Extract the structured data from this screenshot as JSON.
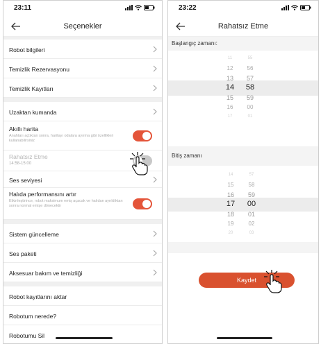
{
  "screen1": {
    "status_time": "23:11",
    "title": "Seçenekler",
    "rows": {
      "robot_info": "Robot bilgileri",
      "cleaning_reservation": "Temizlik Rezervasyonu",
      "cleaning_records": "Temizlik Kayıtları",
      "remote_control": "Uzaktan kumanda",
      "smart_map": "Akıllı harita",
      "smart_map_desc": "Anahtarı açtıktan sonra, haritayı odalara ayırma gibi özellikleri kullanabilirsiniz",
      "dnd": "Rahatsız Etme",
      "dnd_time": "14:58-15:00",
      "volume": "Ses seviyesi",
      "carpet_boost": "Halıda performansını artır",
      "carpet_boost_desc": "Etkinleştirince, robot maksimum emiş açacak ve halıdan ayrıldıktan sonra normal emişe dönecektir",
      "system_update": "Sistem güncelleme",
      "voice_pack": "Ses paketi",
      "accessory_care": "Aksesuar bakım ve temizliği",
      "transfer_robot": "Robot kayıtlarını aktar",
      "find_robot": "Robotum nerede?",
      "delete_robot": "Robotumu Sil"
    },
    "toggles": {
      "smart_map": true,
      "dnd": false,
      "carpet_boost": true
    }
  },
  "screen2": {
    "status_time": "23:22",
    "title": "Rahatsız Etme",
    "start_label": "Başlangıç zamanı:",
    "end_label": "Bitiş zamanı",
    "start_picker": {
      "hours": [
        "11",
        "12",
        "13",
        "14",
        "15",
        "16",
        "17"
      ],
      "minutes": [
        "55",
        "56",
        "57",
        "58",
        "59",
        "00",
        "01"
      ],
      "selected_hour": "14",
      "selected_minute": "58"
    },
    "end_picker": {
      "hours": [
        "14",
        "15",
        "16",
        "17",
        "18",
        "19",
        "20"
      ],
      "minutes": [
        "57",
        "58",
        "59",
        "00",
        "01",
        "02",
        "03"
      ],
      "selected_hour": "17",
      "selected_minute": "00"
    },
    "save_label": "Kaydet"
  },
  "colors": {
    "accent": "#e4553a",
    "button": "#d9512f",
    "muted": "#aaaaaa"
  },
  "icons": [
    "back-arrow-icon",
    "chevron-right-icon",
    "signal-icon",
    "wifi-icon",
    "battery-icon",
    "tap-hand-icon"
  ]
}
